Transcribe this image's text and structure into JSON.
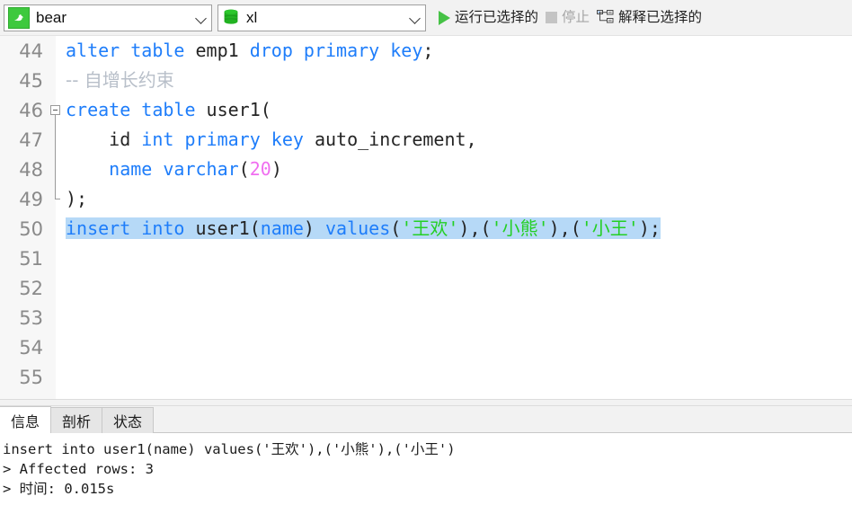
{
  "toolbar": {
    "connection": {
      "icon": "mysql-dolphin-icon",
      "value": "bear",
      "caret": "chevron-down-icon"
    },
    "database": {
      "icon": "database-cylinder-icon",
      "value": "xl",
      "caret": "chevron-down-icon"
    },
    "run_selected": {
      "label": "运行已选择的",
      "icon": "play-icon",
      "enabled": true
    },
    "stop": {
      "label": "停止",
      "icon": "stop-square-icon",
      "enabled": false
    },
    "explain_selected": {
      "label": "解释已选择的",
      "icon": "explain-tree-icon",
      "enabled": true
    }
  },
  "editor": {
    "colors": {
      "keyword": "#1e7dfa",
      "string": "#24cf24",
      "number": "#f06ef0",
      "comment": "#b8bfc9",
      "text": "#242424",
      "selection": "#b6d9f7",
      "gutter_bg": "#f7f7f7",
      "line_number": "#8a8a8a"
    },
    "lines": [
      {
        "number": "44",
        "fold": "none",
        "tokens": [
          {
            "t": "alter table ",
            "c": "kw"
          },
          {
            "t": "emp1 ",
            "c": ""
          },
          {
            "t": "drop primary key",
            "c": "kw"
          },
          {
            "t": ";",
            "c": ""
          }
        ]
      },
      {
        "number": "45",
        "fold": "none",
        "tokens": [
          {
            "t": "-- 自增长约束",
            "c": "cmt"
          }
        ]
      },
      {
        "number": "46",
        "fold": "start",
        "tokens": [
          {
            "t": "create table ",
            "c": "kw"
          },
          {
            "t": "user1(",
            "c": ""
          }
        ]
      },
      {
        "number": "47",
        "fold": "mid",
        "tokens": [
          {
            "t": "    id ",
            "c": ""
          },
          {
            "t": "int primary key",
            "c": "kw"
          },
          {
            "t": " auto_increment,",
            "c": ""
          }
        ]
      },
      {
        "number": "48",
        "fold": "mid",
        "tokens": [
          {
            "t": "    ",
            "c": ""
          },
          {
            "t": "name varchar",
            "c": "kw"
          },
          {
            "t": "(",
            "c": ""
          },
          {
            "t": "20",
            "c": "num"
          },
          {
            "t": ")",
            "c": ""
          }
        ]
      },
      {
        "number": "49",
        "fold": "end",
        "tokens": [
          {
            "t": ");",
            "c": ""
          }
        ]
      },
      {
        "number": "50",
        "fold": "none",
        "selected": true,
        "tokens": [
          {
            "t": "insert into ",
            "c": "kw"
          },
          {
            "t": "user1(",
            "c": ""
          },
          {
            "t": "name",
            "c": "kw"
          },
          {
            "t": ") ",
            "c": ""
          },
          {
            "t": "values",
            "c": "kw"
          },
          {
            "t": "(",
            "c": ""
          },
          {
            "t": "'王欢'",
            "c": "str"
          },
          {
            "t": "),(",
            "c": ""
          },
          {
            "t": "'小熊'",
            "c": "str"
          },
          {
            "t": "),(",
            "c": ""
          },
          {
            "t": "'小王'",
            "c": "str"
          },
          {
            "t": ");",
            "c": ""
          }
        ]
      },
      {
        "number": "51",
        "fold": "none",
        "tokens": []
      },
      {
        "number": "52",
        "fold": "none",
        "tokens": []
      },
      {
        "number": "53",
        "fold": "none",
        "tokens": []
      },
      {
        "number": "54",
        "fold": "none",
        "tokens": []
      },
      {
        "number": "55",
        "fold": "none",
        "tokens": []
      }
    ]
  },
  "bottom_panel": {
    "tabs": [
      {
        "label": "信息",
        "active": true
      },
      {
        "label": "剖析",
        "active": false
      },
      {
        "label": "状态",
        "active": false
      }
    ],
    "output_lines": [
      "insert into user1(name) values('王欢'),('小熊'),('小王')",
      "> Affected rows: 3",
      "> 时间: 0.015s"
    ]
  }
}
